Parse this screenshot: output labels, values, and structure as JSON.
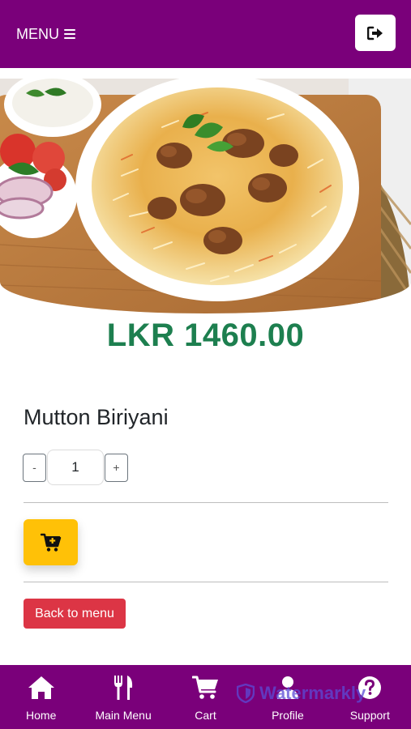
{
  "header": {
    "menu_label": "MENU",
    "menu_icon": "hamburger-icon",
    "logout_icon": "sign-out-icon"
  },
  "product": {
    "image_alt": "Mutton Biriyani",
    "price": "LKR 1460.00",
    "name": "Mutton Biriyani",
    "quantity": "1",
    "decrement_label": "-",
    "increment_label": "+",
    "add_to_cart_icon": "cart-plus-icon",
    "back_label": "Back to menu"
  },
  "colors": {
    "brand": "#7a007a",
    "price": "#1d7f4f",
    "add_to_cart": "#ffc107",
    "back_button": "#dc3545"
  },
  "bottom_nav": [
    {
      "label": "Home",
      "icon": "home-icon"
    },
    {
      "label": "Main Menu",
      "icon": "fork-knife-icon"
    },
    {
      "label": "Cart",
      "icon": "cart-icon"
    },
    {
      "label": "Profile",
      "icon": "user-icon"
    },
    {
      "label": "Support",
      "icon": "question-circle-icon"
    }
  ],
  "watermark": {
    "text": "Watermarkly"
  }
}
